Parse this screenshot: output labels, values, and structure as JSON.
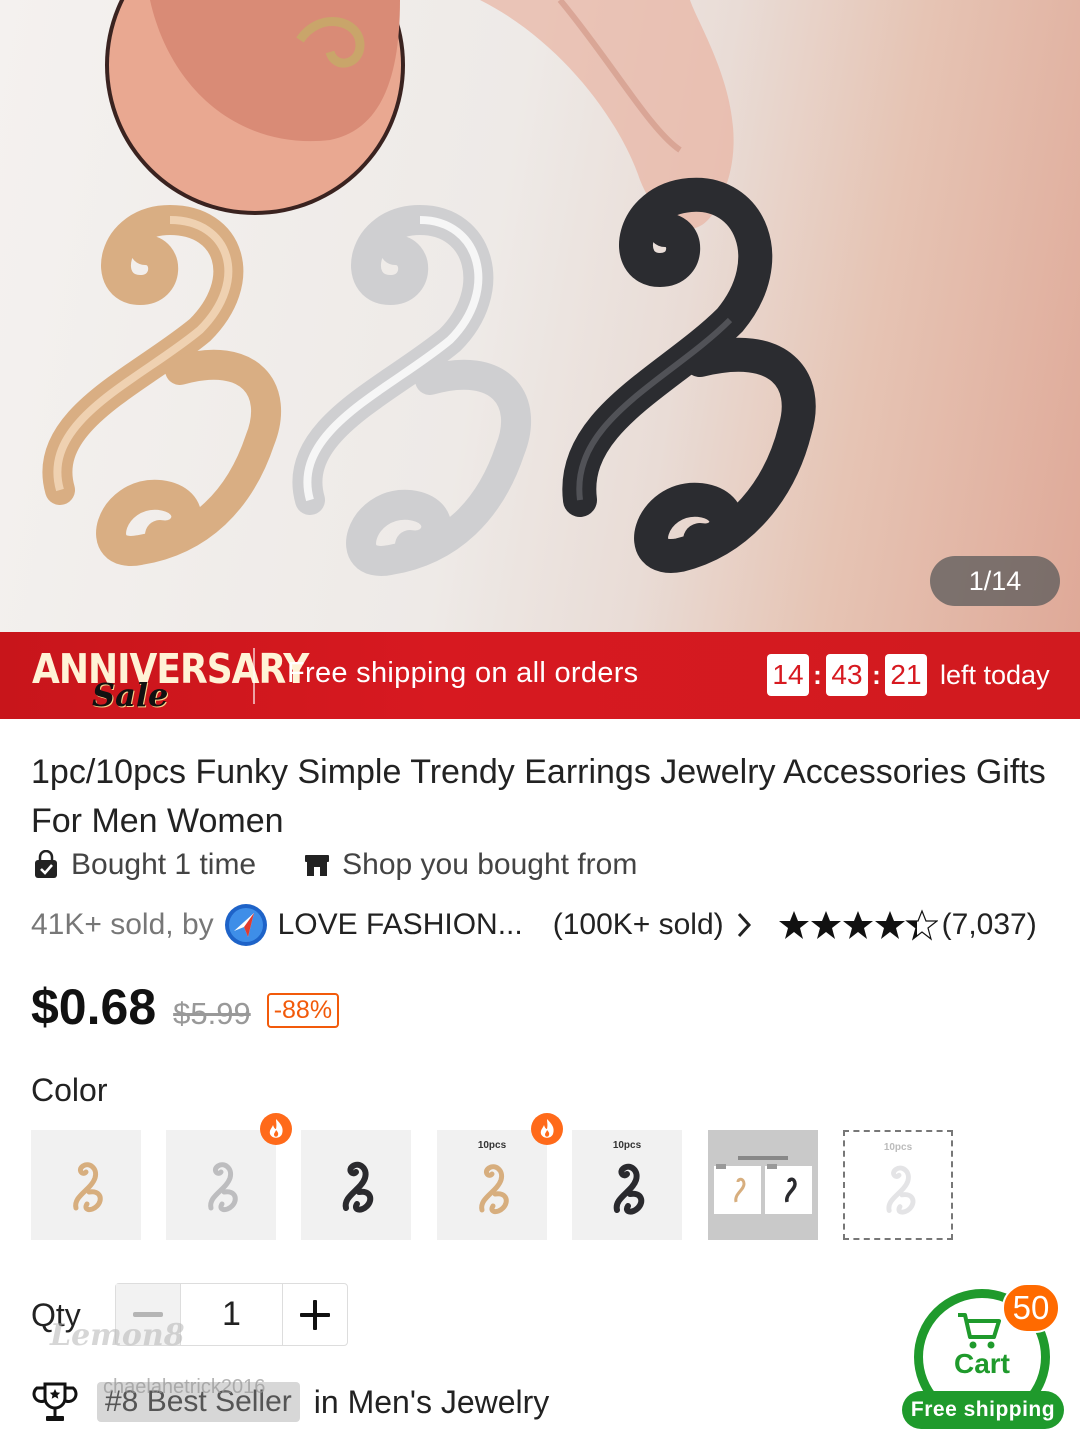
{
  "gallery": {
    "counter": "1/14"
  },
  "banner": {
    "logo_line1": "ANNIVERSARY",
    "logo_line2": "Sale",
    "message": "Free shipping on all orders",
    "timer": {
      "hours": "14",
      "minutes": "43",
      "seconds": "21"
    },
    "timer_suffix": "left today",
    "colors": {
      "background": "#d71920",
      "text": "#ffffff"
    }
  },
  "product": {
    "title": "1pc/10pcs Funky Simple Trendy Earrings Jewelry Accessories Gifts For Men Women",
    "bought": "Bought 1 time",
    "shop_bought": "Shop you bought from",
    "sold_by": "41K+ sold, by",
    "store_name": "LOVE FASHION...",
    "store_sold": "(100K+ sold)",
    "rating_count": "(7,037)",
    "rating": 4.7,
    "price_now": "$0.68",
    "price_was": "$5.99",
    "discount": "-88%"
  },
  "color": {
    "label": "Color",
    "options": [
      {
        "name": "gold",
        "tag": ""
      },
      {
        "name": "silver",
        "tag": ""
      },
      {
        "name": "black",
        "tag": ""
      },
      {
        "name": "gold-10pcs",
        "tag": "10pcs"
      },
      {
        "name": "black-10pcs",
        "tag": "10pcs"
      },
      {
        "name": "bundle",
        "tag": ""
      },
      {
        "name": "silver-10pcs",
        "tag": "10pcs"
      }
    ]
  },
  "qty": {
    "label": "Qty",
    "value": "1"
  },
  "bestseller": {
    "rank": "#8 Best Seller",
    "category": "in Men's Jewelry"
  },
  "watermark": {
    "brand": "Lemon8",
    "user": "chaelahetrick2016"
  },
  "cart": {
    "label": "Cart",
    "count": "50",
    "free_shipping": "Free shipping",
    "accent": "#1f9a2c"
  }
}
